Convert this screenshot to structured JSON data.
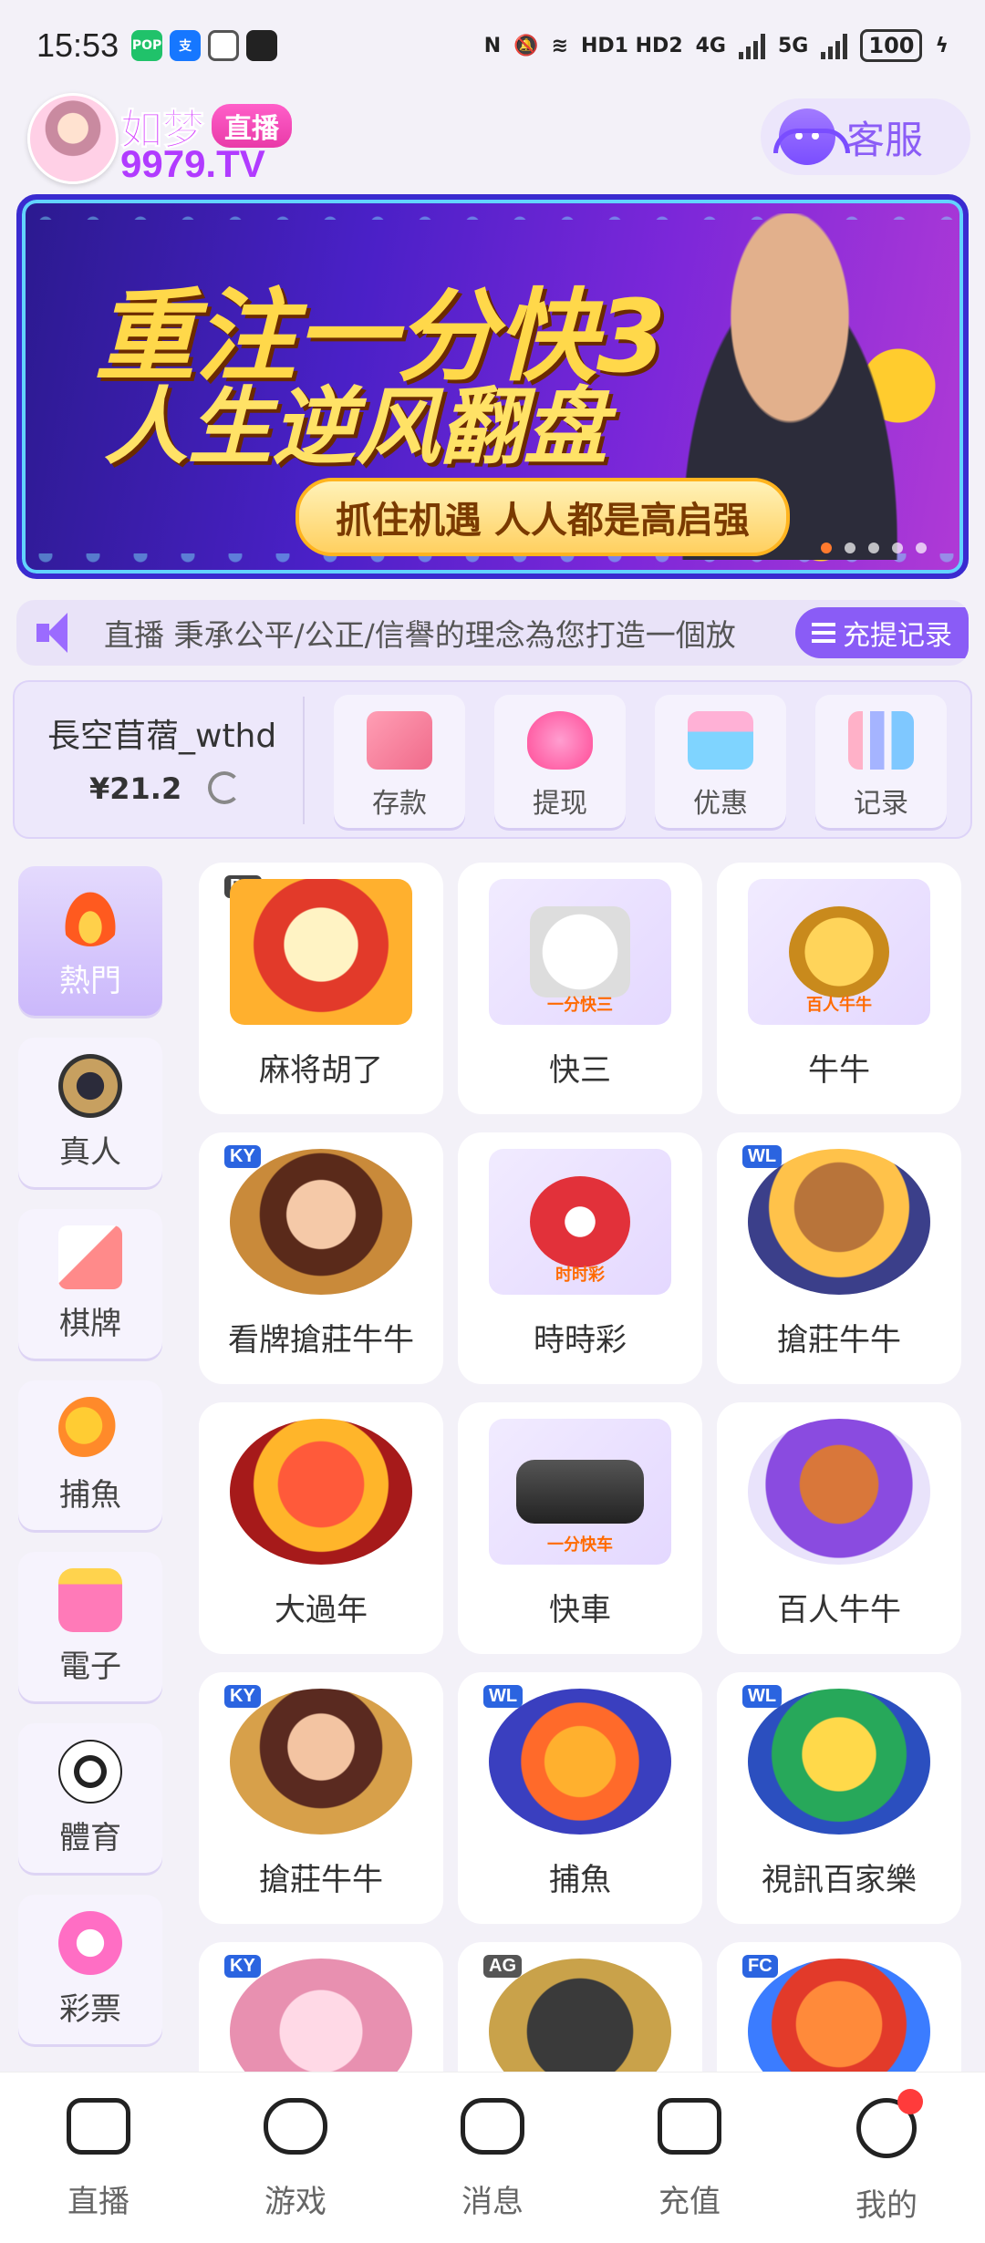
{
  "status": {
    "time": "15:53",
    "network": "HD1 HD2",
    "net1": "4G",
    "net2": "5G",
    "battery": "100"
  },
  "header": {
    "brand_name": "如梦",
    "brand_badge": "直播",
    "brand_url": "9979.TV",
    "service_label": "客服"
  },
  "banner": {
    "line1": "重注一分快3",
    "line2": "人生逆风翻盘",
    "pill": "抓住机遇 人人都是高启强"
  },
  "marquee": {
    "text": "直播 秉承公平/公正/信譽的理念為您打造一個放",
    "button": "充提记录"
  },
  "account": {
    "username": "長空苜蓿_wthd",
    "balance": "¥21.2",
    "actions": [
      {
        "label": "存款",
        "icon": "card-icon",
        "color": "#f06a8a"
      },
      {
        "label": "提现",
        "icon": "money-bag-icon",
        "color": "#ff62a0"
      },
      {
        "label": "优惠",
        "icon": "gift-icon",
        "color": "#6ec8ff"
      },
      {
        "label": "记录",
        "icon": "bar-chart-icon",
        "color": "#7f9cff"
      }
    ]
  },
  "sidenav": [
    {
      "label": "熱門",
      "icon": "fire-icon",
      "active": true
    },
    {
      "label": "真人",
      "icon": "chip-icon",
      "active": false
    },
    {
      "label": "棋牌",
      "icon": "cards-icon",
      "active": false
    },
    {
      "label": "捕魚",
      "icon": "fish-icon",
      "active": false
    },
    {
      "label": "電子",
      "icon": "slot-icon",
      "active": false
    },
    {
      "label": "體育",
      "icon": "soccer-icon",
      "active": false
    },
    {
      "label": "彩票",
      "icon": "lottery-ball-icon",
      "active": false
    }
  ],
  "games": [
    {
      "label": "麻将胡了",
      "provider": "PG",
      "art": "mahjong"
    },
    {
      "label": "快三",
      "provider": "",
      "art": "dice",
      "tag": "一分快三"
    },
    {
      "label": "牛牛",
      "provider": "",
      "art": "bull",
      "tag": "百人牛牛"
    },
    {
      "label": "看牌搶莊牛牛",
      "provider": "KY",
      "art": "cowgirl"
    },
    {
      "label": "時時彩",
      "provider": "",
      "art": "lottery",
      "tag": "时时彩"
    },
    {
      "label": "搶莊牛牛",
      "provider": "WL",
      "art": "cowhat"
    },
    {
      "label": "大過年",
      "provider": "",
      "art": "lion"
    },
    {
      "label": "快車",
      "provider": "",
      "art": "car",
      "tag": "一分快车"
    },
    {
      "label": "百人牛牛",
      "provider": "",
      "art": "cartoonbull"
    },
    {
      "label": "搶莊牛牛",
      "provider": "KY",
      "art": "lady"
    },
    {
      "label": "捕魚",
      "provider": "WL",
      "art": "fishing"
    },
    {
      "label": "視訊百家樂",
      "provider": "WL",
      "art": "baccarat"
    },
    {
      "label": "",
      "provider": "KY",
      "art": "fairy"
    },
    {
      "label": "",
      "provider": "AG",
      "art": "agbaccarat"
    },
    {
      "label": "",
      "provider": "FC",
      "art": "warrior"
    }
  ],
  "bottom_nav": [
    {
      "label": "直播",
      "icon": "camera-icon"
    },
    {
      "label": "游戏",
      "icon": "gamepad-icon"
    },
    {
      "label": "消息",
      "icon": "chat-icon"
    },
    {
      "label": "充值",
      "icon": "wallet-icon"
    },
    {
      "label": "我的",
      "icon": "profile-icon",
      "badge": true
    }
  ]
}
